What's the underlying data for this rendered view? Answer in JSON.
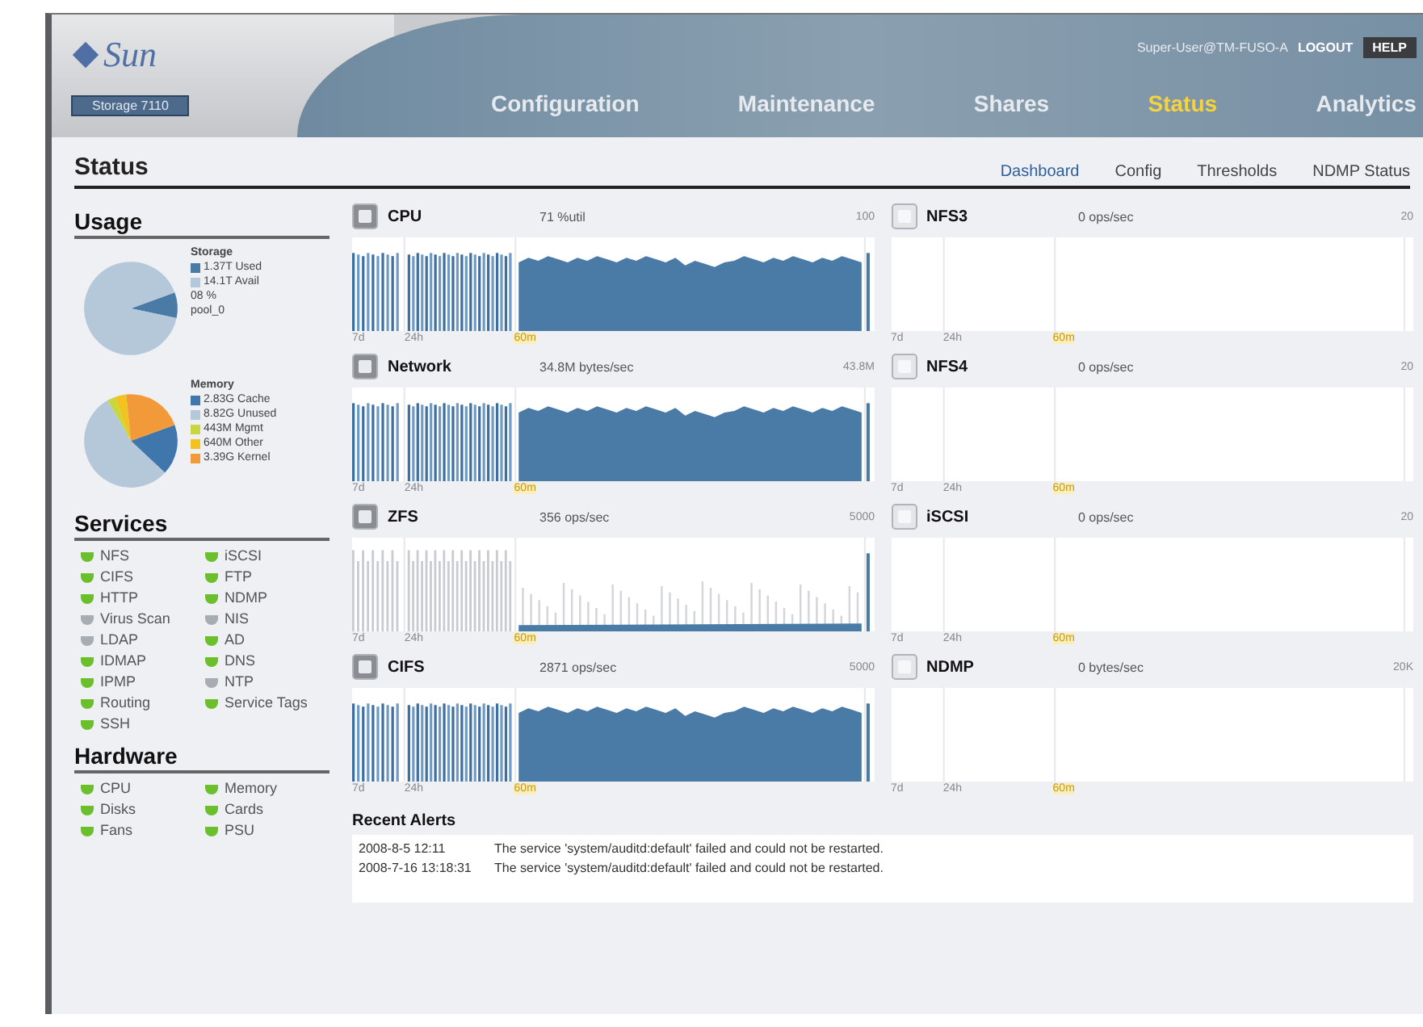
{
  "header": {
    "logo": "Sun",
    "product": "Storage 7110",
    "user": "Super-User@TM-FUSO-A",
    "logout": "LOGOUT",
    "help": "HELP"
  },
  "nav": [
    {
      "label": "Configuration",
      "selected": false
    },
    {
      "label": "Maintenance",
      "selected": false
    },
    {
      "label": "Shares",
      "selected": false
    },
    {
      "label": "Status",
      "selected": true
    },
    {
      "label": "Analytics",
      "selected": false
    }
  ],
  "page_title": "Status",
  "subnav": [
    {
      "label": "Dashboard",
      "selected": true
    },
    {
      "label": "Config",
      "selected": false
    },
    {
      "label": "Thresholds",
      "selected": false
    },
    {
      "label": "NDMP Status",
      "selected": false
    }
  ],
  "usage": {
    "title": "Usage",
    "pies": [
      {
        "chart_data": {
          "type": "pie",
          "title": "Storage",
          "categories": [
            "1.37T Used",
            "14.1T Avail"
          ],
          "values": [
            1.37,
            14.1
          ]
        },
        "legend": [
          {
            "color": "#4a7aa6"
          },
          {
            "color": "#b4c8da"
          }
        ],
        "notes": [
          "08 %",
          "pool_0"
        ]
      },
      {
        "chart_data": {
          "type": "pie",
          "title": "Memory",
          "categories": [
            "2.83G Cache",
            "8.82G Unused",
            "443M Mgmt",
            "640M Other",
            "3.39G Kernel"
          ],
          "values": [
            2.83,
            8.82,
            0.443,
            0.64,
            3.39
          ]
        },
        "legend": [
          {
            "color": "#3f77ad"
          },
          {
            "color": "#b4c8da"
          },
          {
            "color": "#c8d640"
          },
          {
            "color": "#f2c21e"
          },
          {
            "color": "#f29a3a"
          }
        ]
      }
    ]
  },
  "services": {
    "title": "Services",
    "items": [
      {
        "label": "NFS",
        "online": true
      },
      {
        "label": "iSCSI",
        "online": true
      },
      {
        "label": "CIFS",
        "online": true
      },
      {
        "label": "FTP",
        "online": true
      },
      {
        "label": "HTTP",
        "online": true
      },
      {
        "label": "NDMP",
        "online": true
      },
      {
        "label": "Virus Scan",
        "online": false
      },
      {
        "label": "NIS",
        "online": false
      },
      {
        "label": "LDAP",
        "online": false
      },
      {
        "label": "AD",
        "online": true
      },
      {
        "label": "IDMAP",
        "online": true
      },
      {
        "label": "DNS",
        "online": true
      },
      {
        "label": "IPMP",
        "online": true
      },
      {
        "label": "NTP",
        "online": false
      },
      {
        "label": "Routing",
        "online": true
      },
      {
        "label": "Service Tags",
        "online": true
      },
      {
        "label": "SSH",
        "online": true
      }
    ]
  },
  "hardware": {
    "title": "Hardware",
    "items": [
      {
        "label": "CPU",
        "online": true
      },
      {
        "label": "Memory",
        "online": true
      },
      {
        "label": "Disks",
        "online": true
      },
      {
        "label": "Cards",
        "online": true
      },
      {
        "label": "Fans",
        "online": true
      },
      {
        "label": "PSU",
        "online": true
      }
    ]
  },
  "charts": [
    {
      "title": "CPU",
      "reading": "71 %util",
      "max": "100",
      "kind": "busy",
      "axis": [
        "7d",
        "24h",
        "60m"
      ]
    },
    {
      "title": "NFS3",
      "reading": "0 ops/sec",
      "max": "20",
      "kind": "idle",
      "axis": [
        "7d",
        "24h",
        "60m"
      ]
    },
    {
      "title": "Network",
      "reading": "34.8M bytes/sec",
      "max": "43.8M",
      "kind": "busy",
      "axis": [
        "7d",
        "24h",
        "60m"
      ]
    },
    {
      "title": "NFS4",
      "reading": "0 ops/sec",
      "max": "20",
      "kind": "idle",
      "axis": [
        "7d",
        "24h",
        "60m"
      ]
    },
    {
      "title": "ZFS",
      "reading": "356 ops/sec",
      "max": "5000",
      "kind": "spiky",
      "axis": [
        "7d",
        "24h",
        "60m"
      ]
    },
    {
      "title": "iSCSI",
      "reading": "0 ops/sec",
      "max": "20",
      "kind": "idle",
      "axis": [
        "7d",
        "24h",
        "60m"
      ]
    },
    {
      "title": "CIFS",
      "reading": "2871 ops/sec",
      "max": "5000",
      "kind": "busy",
      "axis": [
        "7d",
        "24h",
        "60m"
      ]
    },
    {
      "title": "NDMP",
      "reading": "0 bytes/sec",
      "max": "20K",
      "kind": "idle",
      "axis": [
        "7d",
        "24h",
        "60m"
      ]
    }
  ],
  "alerts": {
    "title": "Recent Alerts",
    "rows": [
      {
        "time": "2008-8-5 12:11",
        "message": "The service 'system/auditd:default' failed and could not be restarted."
      },
      {
        "time": "2008-7-16 13:18:31",
        "message": "The service 'system/auditd:default' failed and could not be restarted."
      }
    ]
  }
}
